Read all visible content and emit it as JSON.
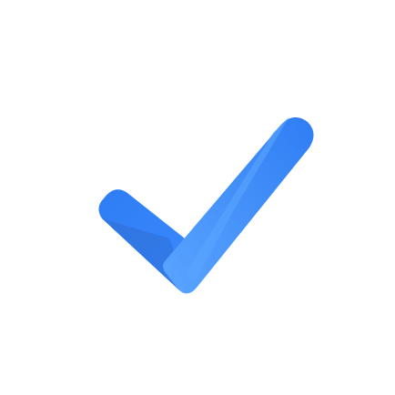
{
  "icon": {
    "name": "checkmark-icon",
    "colors": {
      "background": "#ffffff",
      "light_blue": "#5aa5ff",
      "mid_blue": "#3d8bff",
      "deep_blue": "#2f7df4",
      "shadow_blue": "#2e6fd6"
    }
  }
}
